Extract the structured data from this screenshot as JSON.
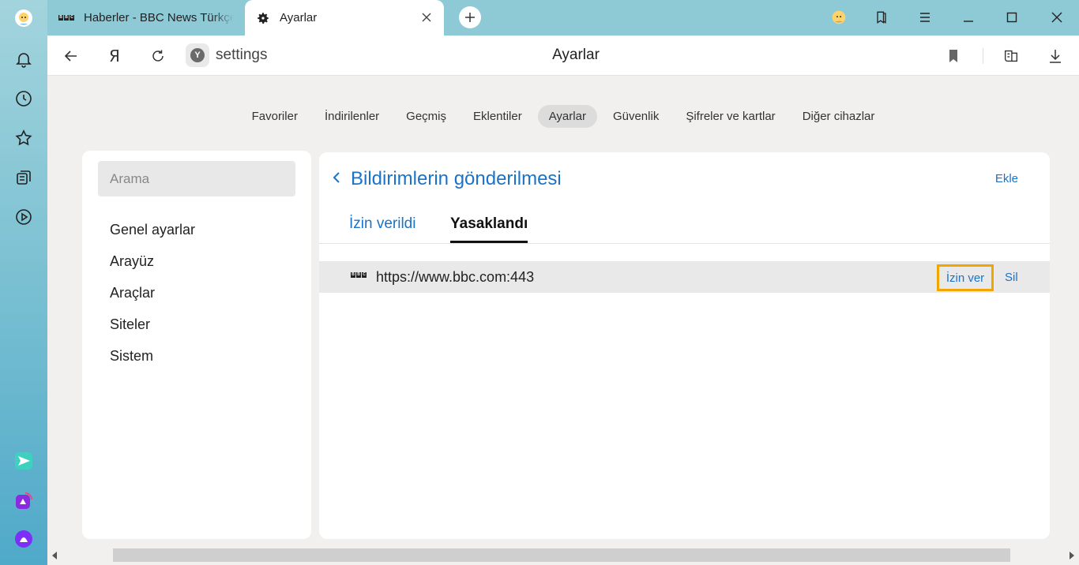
{
  "tabs": [
    {
      "title": "Haberler - BBC News Türkçe",
      "favicon": "bbc-logo"
    },
    {
      "title": "Ayarlar",
      "favicon": "gear-icon"
    }
  ],
  "address": {
    "url": "settings",
    "page_title": "Ayarlar",
    "ya_letter": "Я"
  },
  "topnav": [
    "Favoriler",
    "İndirilenler",
    "Geçmiş",
    "Eklentiler",
    "Ayarlar",
    "Güvenlik",
    "Şifreler ve kartlar",
    "Diğer cihazlar"
  ],
  "topnav_active": "Ayarlar",
  "left_panel": {
    "search_placeholder": "Arama",
    "items": [
      "Genel ayarlar",
      "Arayüz",
      "Araçlar",
      "Siteler",
      "Sistem"
    ]
  },
  "main": {
    "title": "Bildirimlerin gönderilmesi",
    "add_label": "Ekle",
    "tabs": [
      "İzin verildi",
      "Yasaklandı"
    ],
    "active_tab": "Yasaklandı",
    "sites": [
      {
        "url": "https://www.bbc.com:443",
        "allow_label": "İzin ver",
        "delete_label": "Sil"
      }
    ]
  },
  "colors": {
    "accent": "#1a73c8",
    "highlight": "#f0a500"
  }
}
